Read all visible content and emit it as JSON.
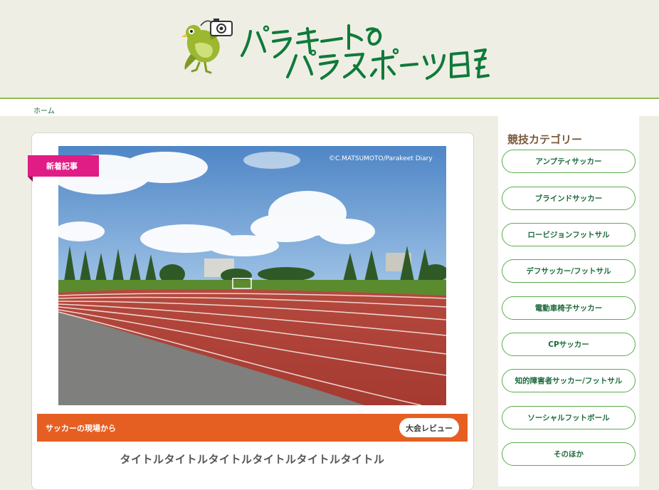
{
  "header": {
    "logo_alt_line1": "パラキートの",
    "logo_alt_line2": "パラスポーツ日記"
  },
  "breadcrumb": {
    "home": "ホーム"
  },
  "article": {
    "badge": "新着記事",
    "photo_credit": "©C.MATSUMOTO/Parakeet Diary",
    "category": "サッカーの現場から",
    "tag": "大会レビュー",
    "title": "タイトルタイトルタイトルタイトルタイトルタイトル"
  },
  "sidebar": {
    "heading": "競技カテゴリー",
    "items": [
      {
        "label": "アンプティサッカー"
      },
      {
        "label": "ブラインドサッカー"
      },
      {
        "label": "ロービジョンフットサル"
      },
      {
        "label": "デフサッカー/フットサル"
      },
      {
        "label": "電動車椅子サッカー"
      },
      {
        "label": "CPサッカー"
      },
      {
        "label": "知的障害者サッカー/フットサル"
      },
      {
        "label": "ソーシャルフットボール"
      },
      {
        "label": "そのほか"
      }
    ]
  },
  "colors": {
    "background": "#eeeee4",
    "accent_green": "#8cc04a",
    "logo_green": "#0f7a3a",
    "badge_pink": "#e01c85",
    "category_orange": "#e65f22",
    "sidebar_heading": "#7a5a3d"
  }
}
